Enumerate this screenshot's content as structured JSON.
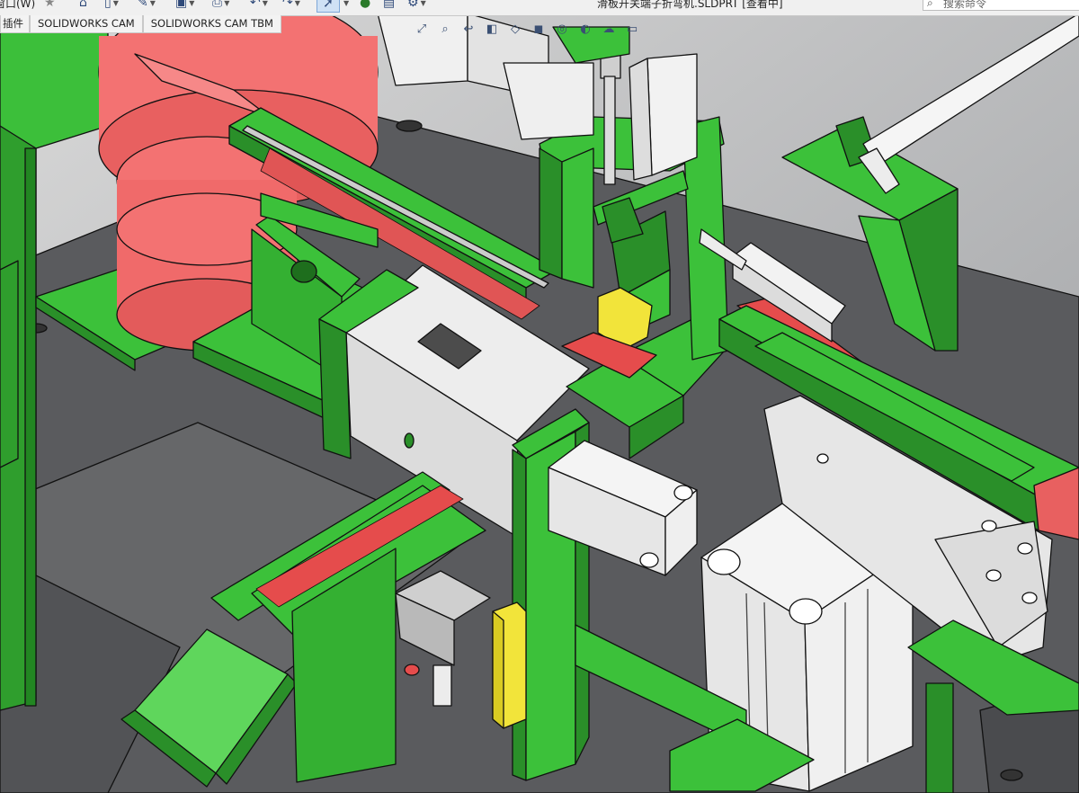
{
  "menu": {
    "window_label": "窗口(W)"
  },
  "document": {
    "title": "滑板开关端子折弯机.SLDPRT [查看中]"
  },
  "search": {
    "placeholder": "搜索命令"
  },
  "tabs": [
    {
      "label": "插件"
    },
    {
      "label": "SOLIDWORKS CAM"
    },
    {
      "label": "SOLIDWORKS CAM TBM"
    }
  ],
  "toolbar": {
    "icons": [
      "home-icon",
      "new-document-icon",
      "sketch-icon",
      "save-icon",
      "print-icon",
      "undo-icon",
      "redo-icon",
      "select-arrow-icon",
      "traffic-light-icon",
      "file-properties-icon",
      "options-gear-icon"
    ]
  },
  "heads_up_view": {
    "icons": [
      "zoom-to-fit-icon",
      "zoom-area-icon",
      "previous-view-icon",
      "section-view-icon",
      "view-orientation-icon",
      "display-style-icon",
      "hide-show-icon",
      "appearance-icon",
      "scene-icon",
      "view-settings-icon"
    ]
  },
  "colors": {
    "part_green": "#3cc13a",
    "part_green_dark": "#2a8f29",
    "part_red": "#f06a6a",
    "part_yellow": "#f2e43a",
    "part_white": "#eeeeee",
    "base_plate": "#5b5c5f",
    "background": "#8f9194"
  }
}
